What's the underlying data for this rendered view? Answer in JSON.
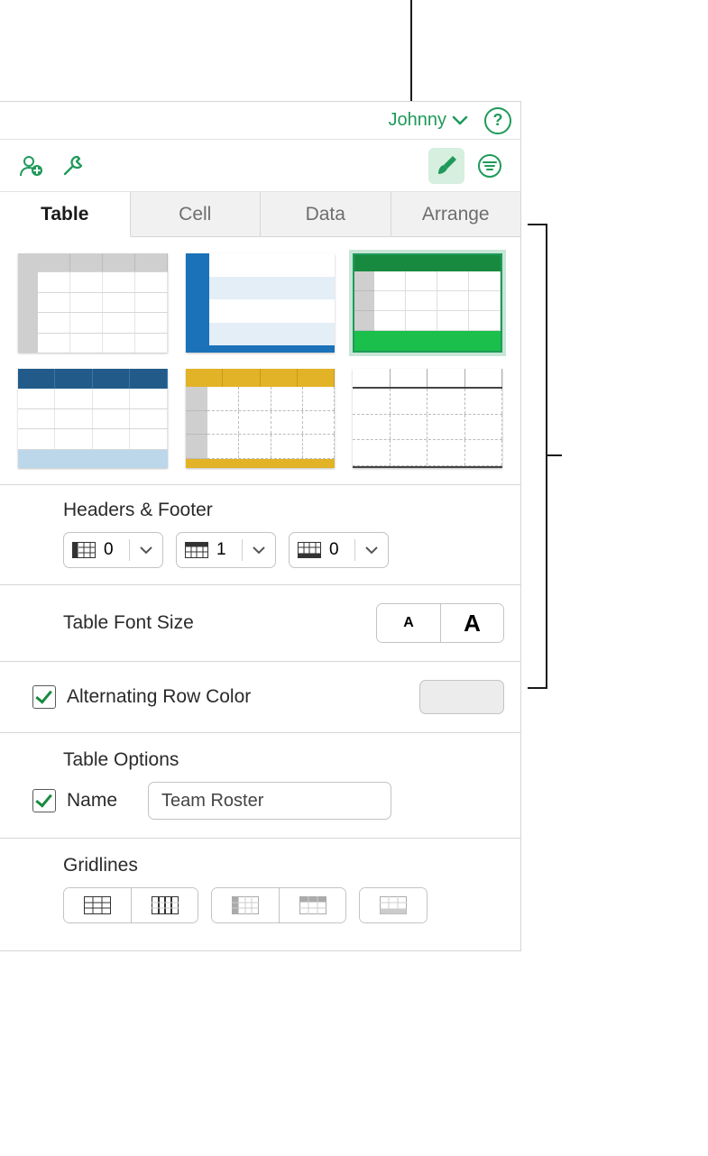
{
  "user": {
    "name": "Johnny"
  },
  "tabs": [
    "Table",
    "Cell",
    "Data",
    "Arrange"
  ],
  "headers_footer": {
    "title": "Headers & Footer",
    "header_cols": "0",
    "header_rows": "1",
    "footer_rows": "0"
  },
  "font_size": {
    "title": "Table Font Size",
    "small": "A",
    "large": "A"
  },
  "alt_row": {
    "label": "Alternating Row Color",
    "checked": true
  },
  "options": {
    "title": "Table Options",
    "name_label": "Name",
    "name_checked": true,
    "name_value": "Team Roster"
  },
  "gridlines": {
    "title": "Gridlines"
  }
}
